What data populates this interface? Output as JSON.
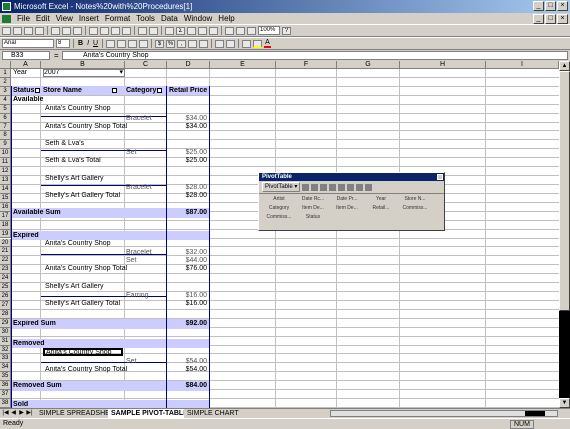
{
  "window": {
    "title": "Microsoft Excel - Notes%20with%20Procedures[1]"
  },
  "menu": [
    "File",
    "Edit",
    "View",
    "Insert",
    "Format",
    "Tools",
    "Data",
    "Window",
    "Help"
  ],
  "toolbar": {
    "font_name": "Arial",
    "font_size": "8",
    "zoom": "100%"
  },
  "formula_bar": {
    "name_box": "B33",
    "fx": "=",
    "value": "Anita's Country Shop"
  },
  "columns": [
    "A",
    "B",
    "C",
    "D",
    "E",
    "F",
    "G",
    "H",
    "I"
  ],
  "rows": [
    "1",
    "2",
    "3",
    "4",
    "5",
    "6",
    "7",
    "8",
    "9",
    "10",
    "11",
    "12",
    "13",
    "14",
    "15",
    "16",
    "17",
    "18",
    "19",
    "20",
    "21",
    "22",
    "23",
    "24",
    "25",
    "26",
    "27",
    "28",
    "29",
    "30",
    "31",
    "32",
    "33",
    "34",
    "35",
    "36",
    "37",
    "38"
  ],
  "sheet": {
    "year_label": "Year",
    "year_value": "2007",
    "headers": {
      "status": "Status",
      "store": "Store Name",
      "category": "Category",
      "price": "Retail Price"
    },
    "available": "Available",
    "anitas": "Anita's Country Shop",
    "bracelet": "Bracelet",
    "v_34_00": "$34.00",
    "anitas_total": "Anita's Country Shop Total",
    "seth": "Seth & Lva's",
    "set": "Set",
    "v_25_00": "$25.00",
    "seth_total": "Seth & Lva's Total",
    "shellys": "Shelly's Art Gallery",
    "v_28_00": "$28.00",
    "shellys_total": "Shelly's Art Gallery Total",
    "available_sum": "Available Sum",
    "v_87_00": "$87.00",
    "expired": "Expired",
    "v_32_00": "$32.00",
    "v_44_00": "$44.00",
    "v_76_00": "$76.00",
    "earring": "Earring",
    "v_16_00": "$16.00",
    "expired_sum": "Expired Sum",
    "v_92_00": "$92.00",
    "removed": "Removed",
    "v_54_00": "$54.00",
    "removed_sum": "Removed Sum",
    "v_84_00": "$84.00",
    "sold": "Sold"
  },
  "tabs": [
    "SIMPLE SPREADSHEET",
    "SAMPLE PIVOT-TABLE",
    "SIMPLE CHART"
  ],
  "status": {
    "left": "Ready",
    "right": "NUM"
  },
  "pivot_toolbar": {
    "title": "PivotTable",
    "menu": "PivotTable ▾",
    "fields": [
      "Artist",
      "Date Rc...",
      "Date Pr...",
      "Year",
      "Store N...",
      "Category",
      "Item De...",
      "Item De...",
      "Retail...",
      "Commiss...",
      "Commiss...",
      "Status"
    ]
  }
}
